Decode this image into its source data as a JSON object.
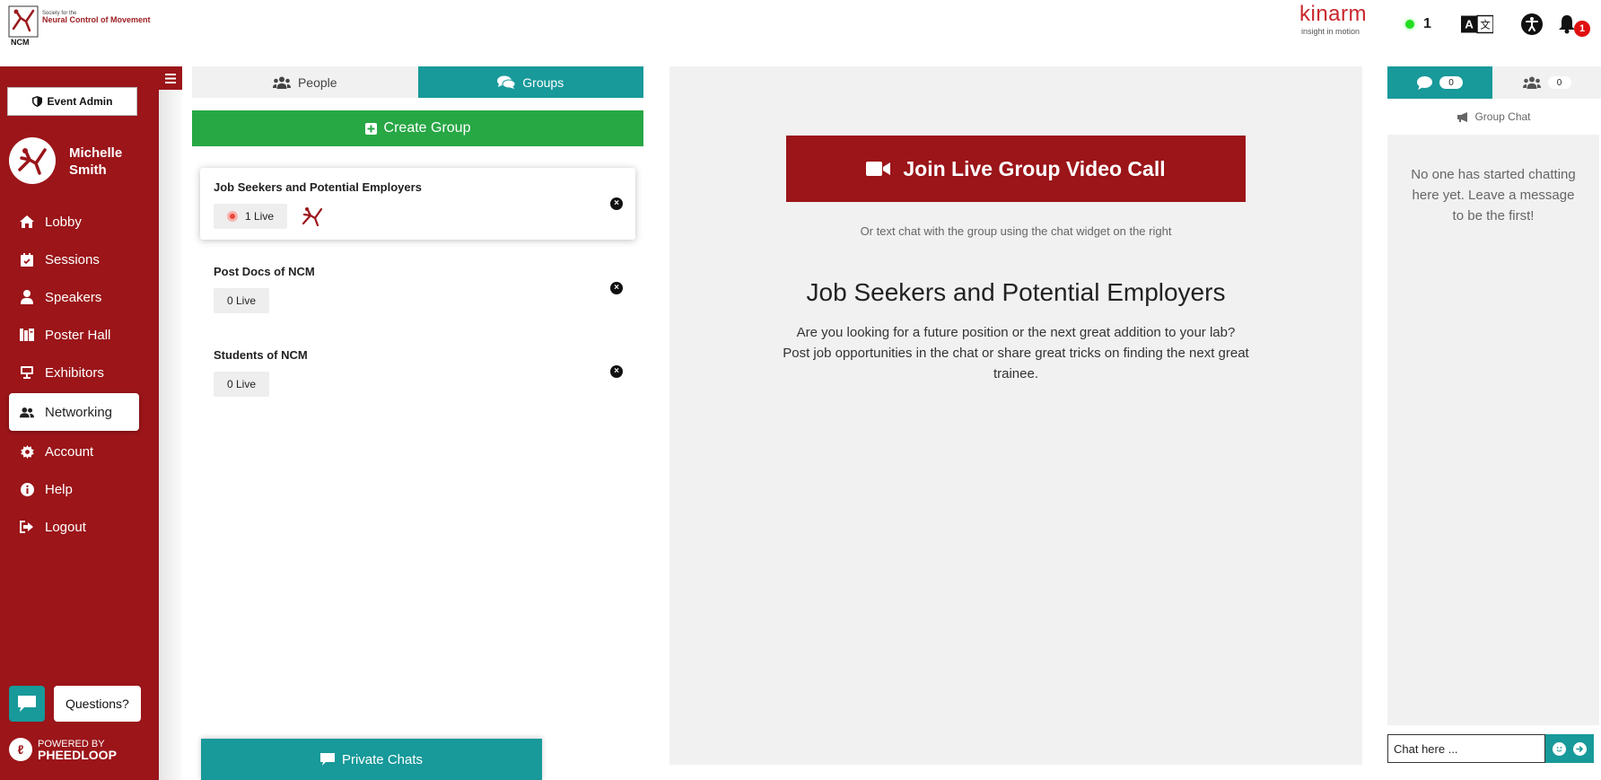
{
  "header": {
    "org_logo": {
      "small_text": "Society for the",
      "name": "Neural Control of Movement",
      "acronym": "NCM"
    },
    "sponsor": {
      "name": "kinarm",
      "tagline": "insight in motion"
    },
    "online_count": "1",
    "notification_count": "1",
    "icons": [
      "translate-icon",
      "accessibility-icon",
      "bell-icon"
    ]
  },
  "sidebar": {
    "event_admin_label": "Event Admin",
    "user": {
      "first_name": "Michelle",
      "last_name": "Smith"
    },
    "items": [
      {
        "label": "Lobby",
        "icon": "home-icon"
      },
      {
        "label": "Sessions",
        "icon": "calendar-icon"
      },
      {
        "label": "Speakers",
        "icon": "speaker-icon"
      },
      {
        "label": "Poster Hall",
        "icon": "poster-icon"
      },
      {
        "label": "Exhibitors",
        "icon": "exhibitor-icon"
      },
      {
        "label": "Networking",
        "icon": "users-icon",
        "active": true
      },
      {
        "label": "Account",
        "icon": "gear-icon"
      },
      {
        "label": "Help",
        "icon": "info-icon"
      },
      {
        "label": "Logout",
        "icon": "logout-icon"
      }
    ],
    "questions_label": "Questions?",
    "powered_by": {
      "line1": "POWERED BY",
      "line2": "PHEEDLOOP"
    }
  },
  "networking": {
    "tabs": [
      {
        "label": "People",
        "icon": "users-icon"
      },
      {
        "label": "Groups",
        "icon": "comments-icon",
        "active": true
      }
    ],
    "create_group_label": "Create Group",
    "groups": [
      {
        "name": "Job Seekers and Potential Employers",
        "live": "1 Live",
        "selected": true
      },
      {
        "name": "Post Docs of NCM",
        "live": "0 Live"
      },
      {
        "name": "Students of NCM",
        "live": "0 Live"
      }
    ],
    "private_chats_label": "Private Chats"
  },
  "main": {
    "join_call_label": "Join Live Group Video Call",
    "hint": "Or text chat with the group using the chat widget on the right",
    "group_title": "Job Seekers and Potential Employers",
    "group_description": "Are you looking for a future position or the next great addition to your lab? Post job opportunities in the chat or share great tricks on finding the next great trainee."
  },
  "chat": {
    "messages_count": "0",
    "members_count": "0",
    "label": "Group Chat",
    "empty_text": "No one has started chatting here yet. Leave a message to be the first!",
    "input_placeholder": "Chat here ..."
  },
  "colors": {
    "brand_red": "#9b1519",
    "teal": "#18999a",
    "green": "#28a745",
    "online_green": "#22dd22"
  }
}
